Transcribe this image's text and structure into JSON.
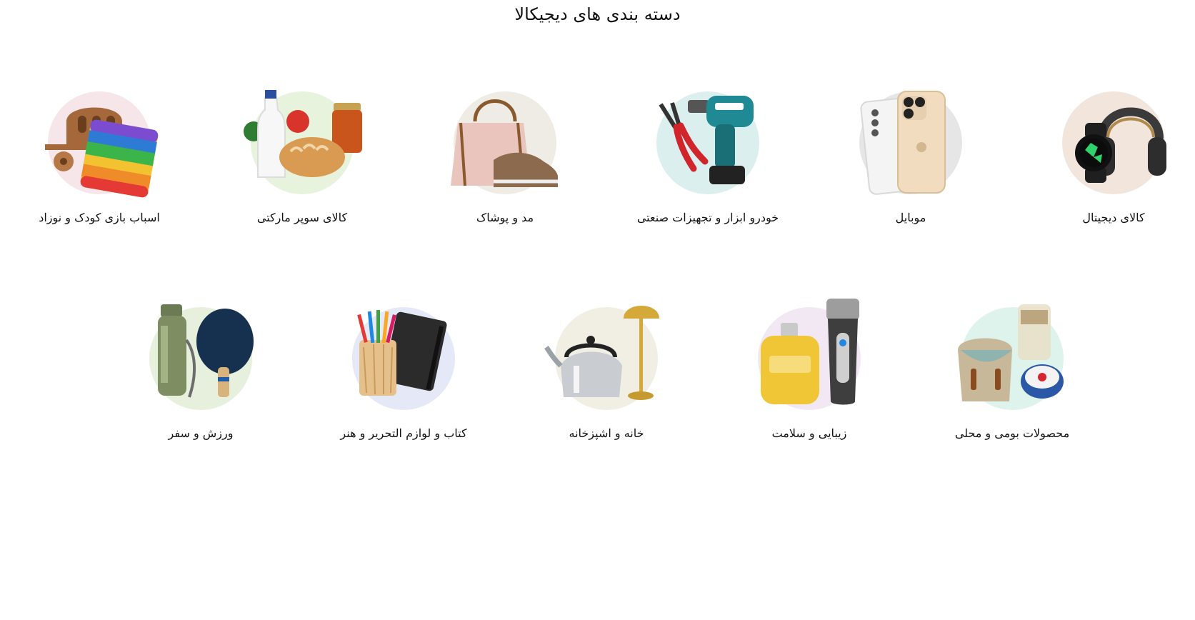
{
  "header": {
    "title": "دسته بندی های دیجیکالا"
  },
  "categories_row1": [
    {
      "label": "کالای دیجیتال",
      "icon": "headphones-watch-icon",
      "bg": "#f2e6dc"
    },
    {
      "label": "موبایل",
      "icon": "smartphones-icon",
      "bg": "#e6e6e6"
    },
    {
      "label": "خودرو ابزار و تجهیزات صنعتی",
      "icon": "drill-pruner-icon",
      "bg": "#dcefef"
    },
    {
      "label": "مد و پوشاک",
      "icon": "handbag-shoe-icon",
      "bg": "#efebe5"
    },
    {
      "label": "کالای سوپر مارکتی",
      "icon": "groceries-icon",
      "bg": "#e8f3dd"
    },
    {
      "label": "اسباب بازی کودک و نوزاد",
      "icon": "toys-icon",
      "bg": "#f6e5e9"
    }
  ],
  "categories_row2": [
    {
      "label": "محصولات بومی و محلی",
      "icon": "local-crafts-icon",
      "bg": "#def3ec"
    },
    {
      "label": "زیبایی و سلامت",
      "icon": "perfume-shaver-icon",
      "bg": "#f1e8f3"
    },
    {
      "label": "خانه و اشپزخانه",
      "icon": "kettle-lamp-icon",
      "bg": "#f1eee3"
    },
    {
      "label": "کتاب و لوازم التحریر و هنر",
      "icon": "notebook-pencils-icon",
      "bg": "#e5e8f6"
    },
    {
      "label": "ورزش و سفر",
      "icon": "flask-paddle-icon",
      "bg": "#e6f0dc"
    }
  ]
}
